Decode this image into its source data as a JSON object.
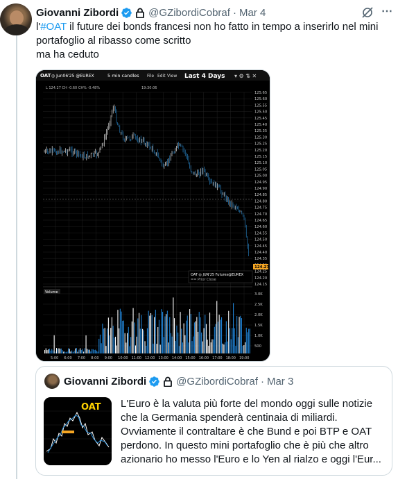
{
  "tweet": {
    "author_name": "Giovanni Zibordi",
    "handle": "@GZibordiCobraf",
    "separator": "·",
    "date": "Mar 4",
    "text_prefix": "l'",
    "hashtag": "#OAT",
    "text_rest": " il future dei bonds francesi non ho fatto in tempo a inserirlo nel mini portafoglio al ribasso come scritto",
    "text_line2": "ma ha ceduto",
    "icons": [
      "verified-badge-icon",
      "lock-icon",
      "grok-icon",
      "more-icon"
    ]
  },
  "chart": {
    "header_symbol": "OAT",
    "header_contract": "◎ Jun06'25 @EUREX",
    "interval": "5 min candles",
    "menu_file": "File",
    "menu_edit": "Edit",
    "menu_view": "View",
    "range_label": "Last 4 Days",
    "info_line": "L 124.27 CH -0.60 CH% -0.48%",
    "time_readout": "19:30:06",
    "legend_title": "OAT ◎ JUN'25 Futures@EUREX",
    "legend_sub": "== Prior Close",
    "last_price": "124.27",
    "volume_label": "Volume",
    "price_axis": [
      "125.65",
      "125.60",
      "125.55",
      "125.50",
      "125.45",
      "125.40",
      "125.35",
      "125.30",
      "125.25",
      "125.20",
      "125.15",
      "125.10",
      "125.05",
      "125.00",
      "124.95",
      "124.90",
      "124.85",
      "124.80",
      "124.75",
      "124.70",
      "124.65",
      "124.60",
      "124.55",
      "124.50",
      "124.45",
      "124.40",
      "124.35",
      "124.30",
      "124.25",
      "124.20",
      "124.15"
    ],
    "volume_axis": [
      "3.0K",
      "2.5K",
      "2.0K",
      "1.5K",
      "1.0K",
      "500"
    ],
    "time_axis": [
      "5:00",
      "6:00",
      "7:00",
      "8:00",
      "9:00",
      "10:00",
      "11:00",
      "12:00",
      "13:00",
      "14:00",
      "15:00",
      "16:00",
      "17:00",
      "18:00",
      "19:00"
    ],
    "colors": {
      "up": "#ffffff",
      "down": "#2b8fd8",
      "volume": "#1f7fcf",
      "grid": "#2a2a2a",
      "header_bg": "#111111"
    }
  },
  "quote": {
    "author_name": "Giovanni Zibordi",
    "handle": "@GZibordiCobraf",
    "separator": "·",
    "date": "Mar 3",
    "thumb_label": "OAT",
    "lines": [
      "L'Euro è la valuta più forte del mondo oggi sulle notizie",
      "che la Germania spenderà centinaia di miliardi.",
      "Ovviamente il contraltare è che Bund e poi BTP e OAT",
      "perdono. In questo mini portafoglio che è più che altro",
      "azionario ho messo l'Euro e lo Yen al rialzo e oggi l'Eur..."
    ]
  }
}
